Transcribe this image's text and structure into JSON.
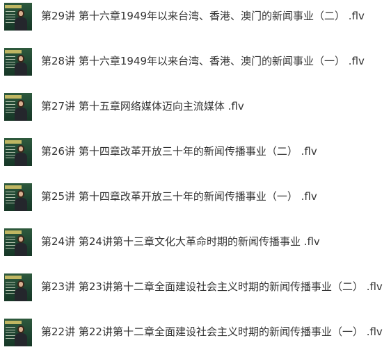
{
  "files": [
    {
      "title": "第29讲 第十六章1949年以来台湾、香港、澳门的新闻事业（二） .flv",
      "thumbnail_icon": "video-thumbnail-lecturer"
    },
    {
      "title": "第28讲 第十六章1949年以来台湾、香港、澳门的新闻事业（一） .flv",
      "thumbnail_icon": "video-thumbnail-lecturer"
    },
    {
      "title": "第27讲 第十五章网络媒体迈向主流媒体 .flv",
      "thumbnail_icon": "video-thumbnail-lecturer"
    },
    {
      "title": "第26讲 第十四章改革开放三十年的新闻传播事业（二） .flv",
      "thumbnail_icon": "video-thumbnail-lecturer"
    },
    {
      "title": "第25讲 第十四章改革开放三十年的新闻传播事业（一） .flv",
      "thumbnail_icon": "video-thumbnail-lecturer"
    },
    {
      "title": "第24讲 第24讲第十三章文化大革命时期的新闻传播事业 .flv",
      "thumbnail_icon": "video-thumbnail-lecturer"
    },
    {
      "title": "第23讲 第23讲第十二章全面建设社会主义时期的新闻传播事业（二） .flv",
      "thumbnail_icon": "video-thumbnail-lecturer"
    },
    {
      "title": "第22讲 第22讲第十二章全面建设社会主义时期的新闻传播事业（一） .flv",
      "thumbnail_icon": "video-thumbnail-lecturer"
    }
  ],
  "colors": {
    "text": "#333333",
    "background": "#ffffff",
    "thumbnail_board": "#1f4a33"
  }
}
